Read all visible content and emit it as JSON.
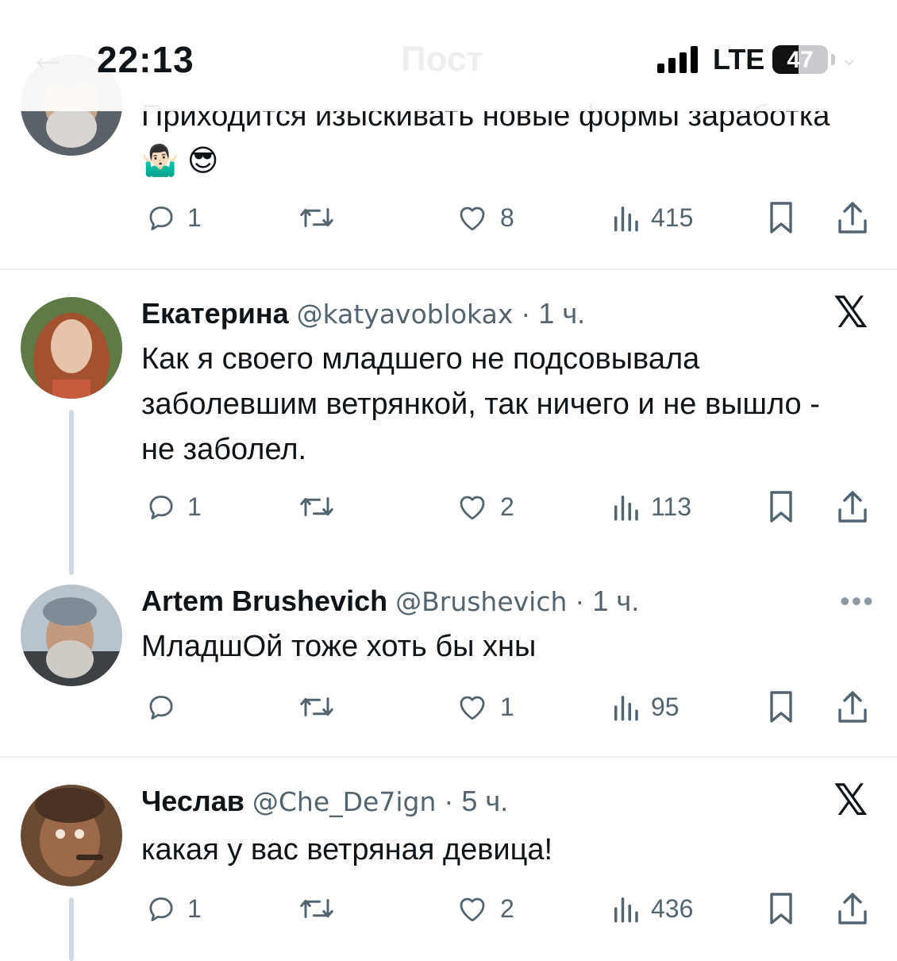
{
  "status_bar": {
    "time": "22:13",
    "faded_title": "Пост",
    "network": "LTE",
    "battery_level": "47",
    "battery_fraction": 0.47
  },
  "tweets": [
    {
      "text": "Приходится изыскивать новые формы заработка🤷🏻‍♂️ 😎",
      "replies": "1",
      "reposts": "",
      "likes": "8",
      "views": "415"
    },
    {
      "name": "Екатерина",
      "handle": "@katyavoblokax",
      "time": "· 1 ч.",
      "text": "Как я своего младшего не подсовывала заболевшим ветрянкой, так ничего и не вышло - не заболел.",
      "replies": "1",
      "reposts": "",
      "likes": "2",
      "views": "113",
      "corner": "𝕏"
    },
    {
      "name": "Artem Brushevich",
      "handle": "@Brushevich",
      "time": "· 1 ч.",
      "text": "МладшОй тоже хоть бы хны",
      "replies": "",
      "reposts": "",
      "likes": "1",
      "views": "95",
      "corner": "•••"
    },
    {
      "name": "Чеслав",
      "handle": "@Che_De7ign",
      "time": "· 5 ч.",
      "text": "какая у вас ветряная девица!",
      "replies": "1",
      "reposts": "",
      "likes": "2",
      "views": "436",
      "corner": "𝕏"
    }
  ],
  "colors": {
    "text": "#0f1419",
    "secondary": "#536471",
    "separator": "#eff3f4",
    "thread_line": "#cfd9de"
  }
}
